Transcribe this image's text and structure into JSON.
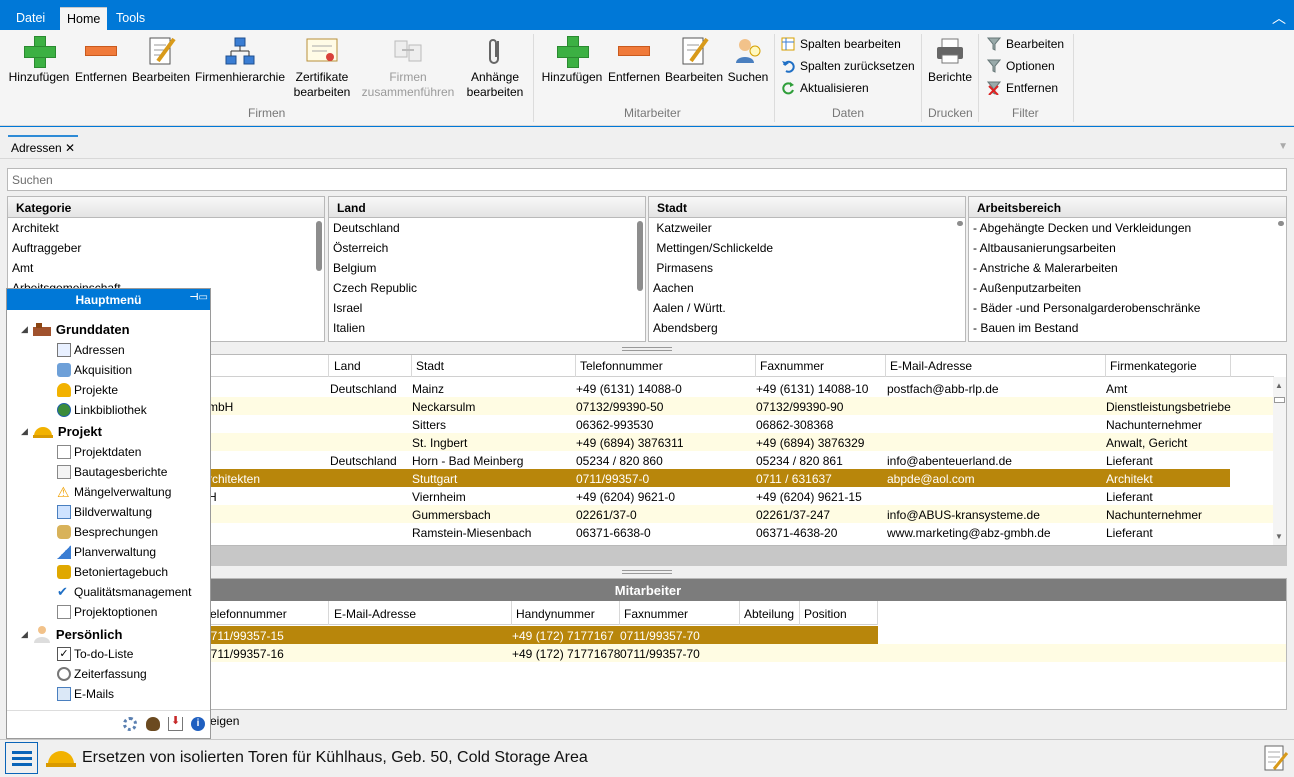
{
  "ribbon": {
    "tabs": [
      "Datei",
      "Home",
      "Tools"
    ],
    "firmen": {
      "add": "Hinzufügen",
      "remove": "Entfernen",
      "edit": "Bearbeiten",
      "hierarchy": "Firmenhierarchie",
      "cert_1": "Zertifikate",
      "cert_2": "bearbeiten",
      "merge_1": "Firmen",
      "merge_2": "zusammenführen",
      "attach_1": "Anhänge",
      "attach_2": "bearbeiten",
      "group": "Firmen"
    },
    "mitarbeiter": {
      "add": "Hinzufügen",
      "remove": "Entfernen",
      "edit": "Bearbeiten",
      "search": "Suchen",
      "group": "Mitarbeiter"
    },
    "daten": {
      "edit_cols": "Spalten bearbeiten",
      "reset_cols": "Spalten zurücksetzen",
      "refresh": "Aktualisieren",
      "group": "Daten"
    },
    "drucken": {
      "reports": "Berichte",
      "group": "Drucken"
    },
    "filter": {
      "edit": "Bearbeiten",
      "options": "Optionen",
      "remove": "Entfernen",
      "group": "Filter"
    }
  },
  "doc_tab": {
    "label": "Adressen",
    "close": "✕"
  },
  "search": {
    "placeholder": "Suchen"
  },
  "filters": {
    "kategorie": {
      "title": "Kategorie",
      "items": [
        "Architekt",
        "Auftraggeber",
        "Amt",
        "Arbeitsgemeinschaft"
      ]
    },
    "land": {
      "title": "Land",
      "items": [
        "Deutschland",
        "Österreich",
        "Belgium",
        "Czech Republic",
        "Israel",
        "Italien"
      ]
    },
    "stadt": {
      "title": "Stadt",
      "items": [
        " Katzweiler",
        " Mettingen/Schlickelde",
        " Pirmasens",
        "Aachen",
        "Aalen / Württ.",
        "Abendsberg"
      ]
    },
    "arbeitsbereich": {
      "title": "Arbeitsbereich",
      "items": [
        "- Abgehängte Decken und Verkleidungen",
        "- Altbausanierungsarbeiten",
        "- Anstriche & Malerarbeiten",
        "- Außenputzarbeiten",
        "- Bäder -und Personalgarderobenschränke",
        "- Bauen im Bestand"
      ]
    }
  },
  "grid": {
    "columns": [
      "Land",
      "Stadt",
      "Telefonnummer",
      "Faxnummer",
      "E-Mail-Adresse",
      "Firmenkategorie"
    ],
    "rows": [
      {
        "name": "",
        "land": "Deutschland",
        "stadt": "Mainz",
        "tel": "+49 (6131) 14088-0",
        "fax": "+49 (6131) 14088-10",
        "mail": "postfach@abb-rlp.de",
        "kat": "Amt"
      },
      {
        "name": "mbH",
        "land": "",
        "stadt": "Neckarsulm",
        "tel": "07132/99390-50",
        "fax": "07132/99390-90",
        "mail": "",
        "kat": "Dienstleistungsbetriebe"
      },
      {
        "name": "",
        "land": "",
        "stadt": "Sitters",
        "tel": "06362-993530",
        "fax": "06862-308368",
        "mail": "",
        "kat": "Nachunternehmer"
      },
      {
        "name": "",
        "land": "",
        "stadt": "St. Ingbert",
        "tel": "+49 (6894) 3876311",
        "fax": "+49 (6894) 3876329",
        "mail": "",
        "kat": "Anwalt, Gericht"
      },
      {
        "name": "",
        "land": "Deutschland",
        "stadt": "Horn - Bad Meinberg",
        "tel": "05234 / 820 860",
        "fax": "05234 / 820 861",
        "mail": "info@abenteuerland.de",
        "kat": "Lieferant"
      },
      {
        "name": "rchitekten",
        "land": "",
        "stadt": "Stuttgart",
        "tel": "0711/99357-0",
        "fax": "0711 / 631637",
        "mail": "abpde@aol.com",
        "kat": "Architekt"
      },
      {
        "name": "H",
        "land": "",
        "stadt": "Viernheim",
        "tel": "+49 (6204) 9621-0",
        "fax": "+49 (6204) 9621-15",
        "mail": "",
        "kat": "Lieferant"
      },
      {
        "name": "",
        "land": "",
        "stadt": "Gummersbach",
        "tel": "02261/37-0",
        "fax": "02261/37-247",
        "mail": "info@ABUS-kransysteme.de",
        "kat": "Nachunternehmer"
      },
      {
        "name": "",
        "land": "",
        "stadt": "Ramstein-Miesenbach",
        "tel": "06371-6638-0",
        "fax": "06371-4638-20",
        "mail": "www.marketing@abz-gmbh.de",
        "kat": "Lieferant"
      }
    ]
  },
  "employees": {
    "title": "Mitarbeiter",
    "columns": [
      "Telefonnummer",
      "E-Mail-Adresse",
      "Handynummer",
      "Faxnummer",
      "Abteilung",
      "Position"
    ],
    "rows": [
      {
        "tel": "0711/99357-15",
        "mail": "",
        "mobile": "+49 (172) 7177167",
        "fax": "0711/99357-70"
      },
      {
        "tel": "0711/99357-16",
        "mail": "",
        "mobile": "+49 (172) 71771678",
        "fax": "0711/99357-70"
      }
    ],
    "footer": "eigen"
  },
  "hauptmenu": {
    "title": "Hauptmenü",
    "sections": [
      {
        "label": "Grunddaten",
        "items": [
          "Adressen",
          "Akquisition",
          "Projekte",
          "Linkbibliothek"
        ]
      },
      {
        "label": "Projekt",
        "items": [
          "Projektdaten",
          "Bautagesberichte",
          "Mängelverwaltung",
          "Bildverwaltung",
          "Besprechungen",
          "Planverwaltung",
          "Betoniertagebuch",
          "Qualitätsmanagement",
          "Projektoptionen"
        ]
      },
      {
        "label": "Persönlich",
        "items": [
          "To-do-Liste",
          "Zeiterfassung",
          "E-Mails"
        ]
      }
    ]
  },
  "status": {
    "text": "Ersetzen von isolierten Toren für Kühlhaus, Geb. 50, Cold Storage Area"
  }
}
